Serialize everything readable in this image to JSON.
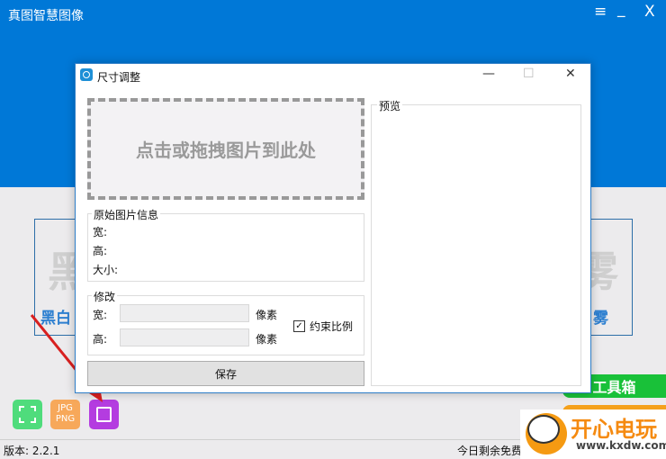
{
  "app": {
    "title": "真图智慧图像",
    "menu_icon": "≡",
    "minimize_icon": "_",
    "close_icon": "X"
  },
  "cards": {
    "left_label": "黑白",
    "left_glyph": "黑",
    "right_label": "雾",
    "right_glyph": "雾"
  },
  "dialog": {
    "title": "尺寸调整",
    "minimize": "—",
    "maximize": "☐",
    "close": "✕",
    "drop_text": "点击或拖拽图片到此处",
    "info": {
      "title": "原始图片信息",
      "width_label": "宽:",
      "height_label": "高:",
      "size_label": "大小:"
    },
    "modify": {
      "title": "修改",
      "width_label": "宽:",
      "height_label": "高:",
      "width_value": "",
      "height_value": "",
      "unit": "像素",
      "constrain_label": "约束比例",
      "constrain_checked": true
    },
    "save_label": "保存",
    "preview_title": "预览"
  },
  "tools": {
    "jpg_png": "JPG\nPNG",
    "toolbox_label": "工具箱"
  },
  "status": {
    "version_label": "版本: 2.2.1",
    "free_remaining": "今日剩余免费"
  },
  "watermark": {
    "brand": "开心电玩",
    "url": "www.kxdw.com"
  }
}
